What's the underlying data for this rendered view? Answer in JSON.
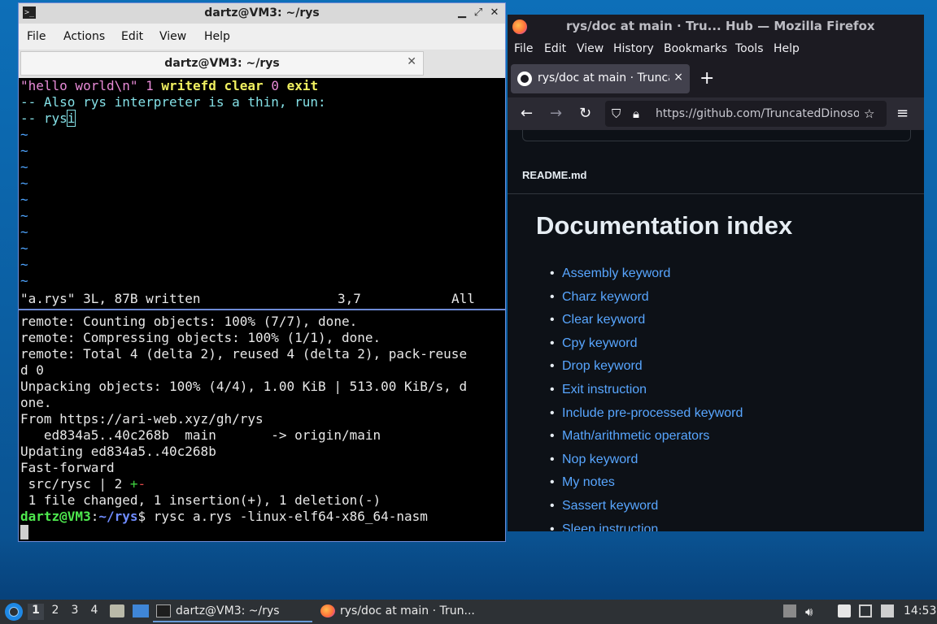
{
  "terminal": {
    "title": "dartz@VM3: ~/rys",
    "menu": [
      "File",
      "Actions",
      "Edit",
      "View",
      "Help"
    ],
    "tab_label": "dartz@VM3: ~/rys",
    "vim": {
      "line1": {
        "str": "\"hello world\\n\"",
        "num1": "1",
        "kw1": "writefd",
        "kw2": "clear",
        "num2": "0",
        "kw3": "exit"
      },
      "line2": "-- Also rys interpreter is a thin, run:",
      "line3_prefix": "-- rys",
      "line3_cursor": "i",
      "tilde": "~",
      "status_left": "\"a.rys\" 3L, 87B written",
      "status_pos": "3,7",
      "status_right": "All"
    },
    "shell": {
      "lines": [
        "remote: Counting objects: 100% (7/7), done.",
        "remote: Compressing objects: 100% (1/1), done.",
        "remote: Total 4 (delta 2), reused 4 (delta 2), pack-reuse",
        "d 0",
        "Unpacking objects: 100% (4/4), 1.00 KiB | 513.00 KiB/s, d",
        "one.",
        "From https://ari-web.xyz/gh/rys",
        "   ed834a5..40c268b  main       -> origin/main",
        "Updating ed834a5..40c268b",
        "Fast-forward"
      ],
      "diffstat_file": " src/rysc | 2 ",
      "diffstat_plus": "+",
      "diffstat_minus": "-",
      "summary": " 1 file changed, 1 insertion(+), 1 deletion(-)",
      "prompt_user": "dartz@VM3",
      "prompt_colon": ":",
      "prompt_path": "~/rys",
      "prompt_sign": "$",
      "command": " rysc a.rys -linux-elf64-x86_64-nasm"
    }
  },
  "firefox": {
    "title": "rys/doc at main · Tru... Hub — Mozilla Firefox",
    "menu": [
      "File",
      "Edit",
      "View",
      "History",
      "Bookmarks",
      "Tools",
      "Help"
    ],
    "tab_label": "rys/doc at main · TruncatedDinosour",
    "tab_close": "×",
    "new_tab": "+",
    "url": "https://github.com/TruncatedDinosour/rys/tree/main/doc",
    "readme_label": "README.md",
    "heading": "Documentation index",
    "links": [
      "Assembly keyword",
      "Charz keyword",
      "Clear keyword",
      "Cpy keyword",
      "Drop keyword",
      "Exit instruction",
      "Include pre-processed keyword",
      "Math/arithmetic operators",
      "Nop keyword",
      "My notes",
      "Sassert keyword",
      "Sleep instruction"
    ]
  },
  "taskbar": {
    "workspaces": [
      "1",
      "2",
      "3",
      "4"
    ],
    "active_workspace": "1",
    "task_terminal": "dartz@VM3: ~/rys",
    "task_firefox": "rys/doc at main · Trun...",
    "clock": "14:53"
  }
}
